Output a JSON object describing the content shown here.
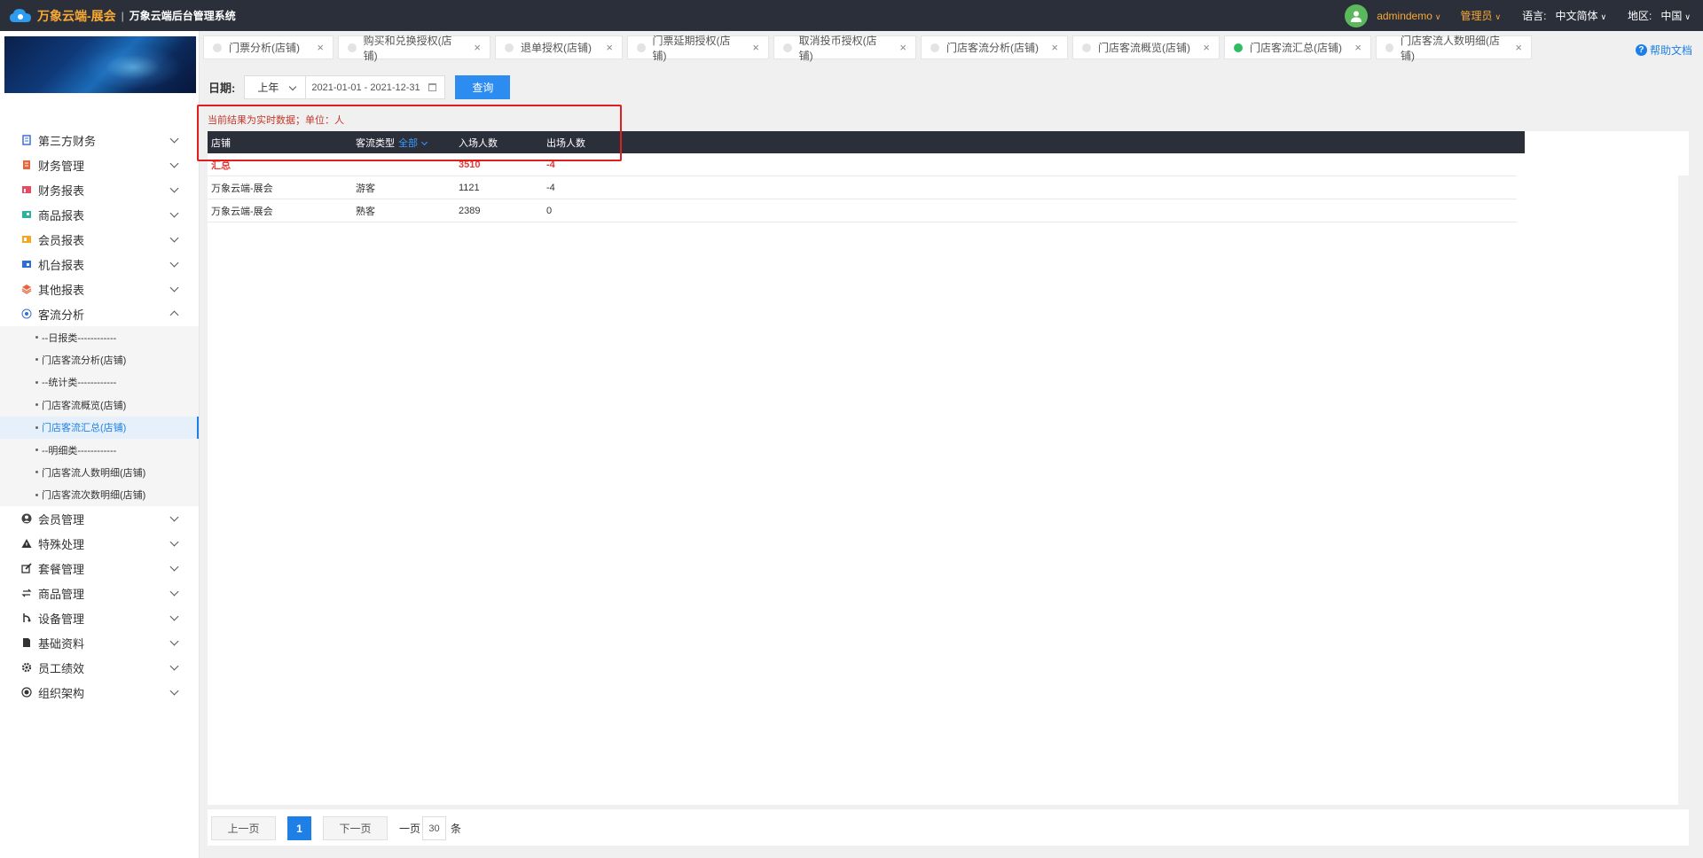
{
  "header": {
    "brand": "万象云端-展会",
    "separator": "|",
    "system_name": "万象云端后台管理系统",
    "username": "admindemo",
    "role": "管理员",
    "language_label": "语言:",
    "language_value": "中文简体",
    "region_label": "地区:",
    "region_value": "中国"
  },
  "sidebar": {
    "menu_top": [
      {
        "label": "第三方财务",
        "icon": "document-icon",
        "color": "#3b6fd6"
      },
      {
        "label": "财务管理",
        "icon": "ledger-icon",
        "color": "#e8663d"
      },
      {
        "label": "财务报表",
        "icon": "report-icon",
        "color": "#e84a5f"
      },
      {
        "label": "商品报表",
        "icon": "goods-report-icon",
        "color": "#2bb3a0"
      },
      {
        "label": "会员报表",
        "icon": "member-report-icon",
        "color": "#f5a623"
      },
      {
        "label": "机台报表",
        "icon": "machine-report-icon",
        "color": "#2d6fd6"
      },
      {
        "label": "其他报表",
        "icon": "layers-icon",
        "color": "#e8663d"
      },
      {
        "label": "客流分析",
        "icon": "target-icon",
        "color": "#3b6fd6"
      }
    ],
    "submenu": [
      {
        "label": "--日报类------------"
      },
      {
        "label": "门店客流分析(店铺)"
      },
      {
        "label": "--统计类------------"
      },
      {
        "label": "门店客流概览(店铺)"
      },
      {
        "label": "门店客流汇总(店铺)",
        "active": true
      },
      {
        "label": "--明细类------------"
      },
      {
        "label": "门店客流人数明细(店铺)"
      },
      {
        "label": "门店客流次数明细(店铺)"
      }
    ],
    "menu_bottom": [
      {
        "label": "会员管理",
        "icon": "user-icon"
      },
      {
        "label": "特殊处理",
        "icon": "warning-icon"
      },
      {
        "label": "套餐管理",
        "icon": "edit-icon"
      },
      {
        "label": "商品管理",
        "icon": "swap-icon"
      },
      {
        "label": "设备管理",
        "icon": "device-icon"
      },
      {
        "label": "基础资料",
        "icon": "file-icon"
      },
      {
        "label": "员工绩效",
        "icon": "gear-icon"
      },
      {
        "label": "组织架构",
        "icon": "org-icon"
      }
    ]
  },
  "tabs": [
    {
      "label": "门票分析(店铺)",
      "active": false
    },
    {
      "label": "购买和兑换授权(店铺)",
      "active": false
    },
    {
      "label": "退单授权(店铺)",
      "active": false
    },
    {
      "label": "门票延期授权(店铺)",
      "active": false
    },
    {
      "label": "取消投币授权(店铺)",
      "active": false
    },
    {
      "label": "门店客流分析(店铺)",
      "active": false
    },
    {
      "label": "门店客流概览(店铺)",
      "active": false
    },
    {
      "label": "门店客流汇总(店铺)",
      "active": true
    },
    {
      "label": "门店客流人数明细(店铺)",
      "active": false
    }
  ],
  "help_label": "帮助文档",
  "filter": {
    "date_label": "日期:",
    "period_value": "上年",
    "date_range": "2021-01-01 - 2021-12-31",
    "query_button": "查询"
  },
  "note": "当前结果为实时数据；单位：人",
  "table": {
    "columns": [
      "店铺",
      "客流类型",
      "入场人数",
      "出场人数"
    ],
    "type_filter": "全部",
    "total_row": {
      "store": "汇总",
      "type": "",
      "in": "3510",
      "out": "-4"
    },
    "rows": [
      {
        "store": "万象云端-展会",
        "type": "游客",
        "in": "1121",
        "out": "-4"
      },
      {
        "store": "万象云端-展会",
        "type": "熟客",
        "in": "2389",
        "out": "0"
      }
    ]
  },
  "pagination": {
    "prev": "上一页",
    "current": "1",
    "next": "下一页",
    "per_page_label": "一页",
    "per_page": "30",
    "unit": "条"
  }
}
